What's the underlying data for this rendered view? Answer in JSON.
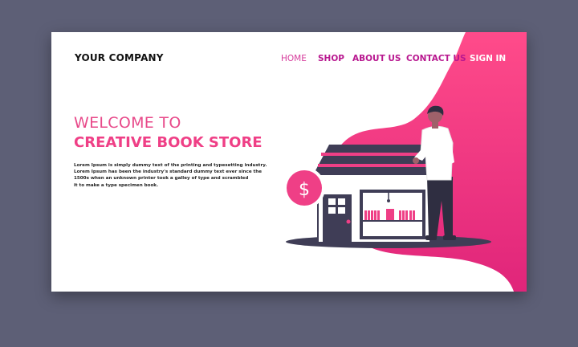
{
  "brand": {
    "name": "YOUR COMPANY"
  },
  "nav": {
    "items": [
      {
        "label": "HOME"
      },
      {
        "label": "SHOP"
      },
      {
        "label": "ABOUT US"
      },
      {
        "label": "CONTACT US"
      },
      {
        "label": "SIGN IN"
      }
    ]
  },
  "hero": {
    "title_line1": "WELCOME TO",
    "title_line2": "CREATIVE BOOK STORE",
    "description_lines": [
      "Lorem Ipsum is simply dummy text of the printing and typesetting industry.",
      "Lorem Ipsum has been the industry's standard dummy text ever since the",
      "1500s when an unknown printer took a galley of type and scrambled",
      "it to make a type specimen book."
    ]
  },
  "illustration": {
    "icons": [
      "dollar-coin-icon",
      "bookstore-building",
      "person-figure"
    ],
    "coin_symbol": "$"
  },
  "colors": {
    "background": "#5d5f76",
    "accent_pink": "#ef3f86",
    "accent_magenta": "#b8178f",
    "dark": "#3f3d56"
  }
}
